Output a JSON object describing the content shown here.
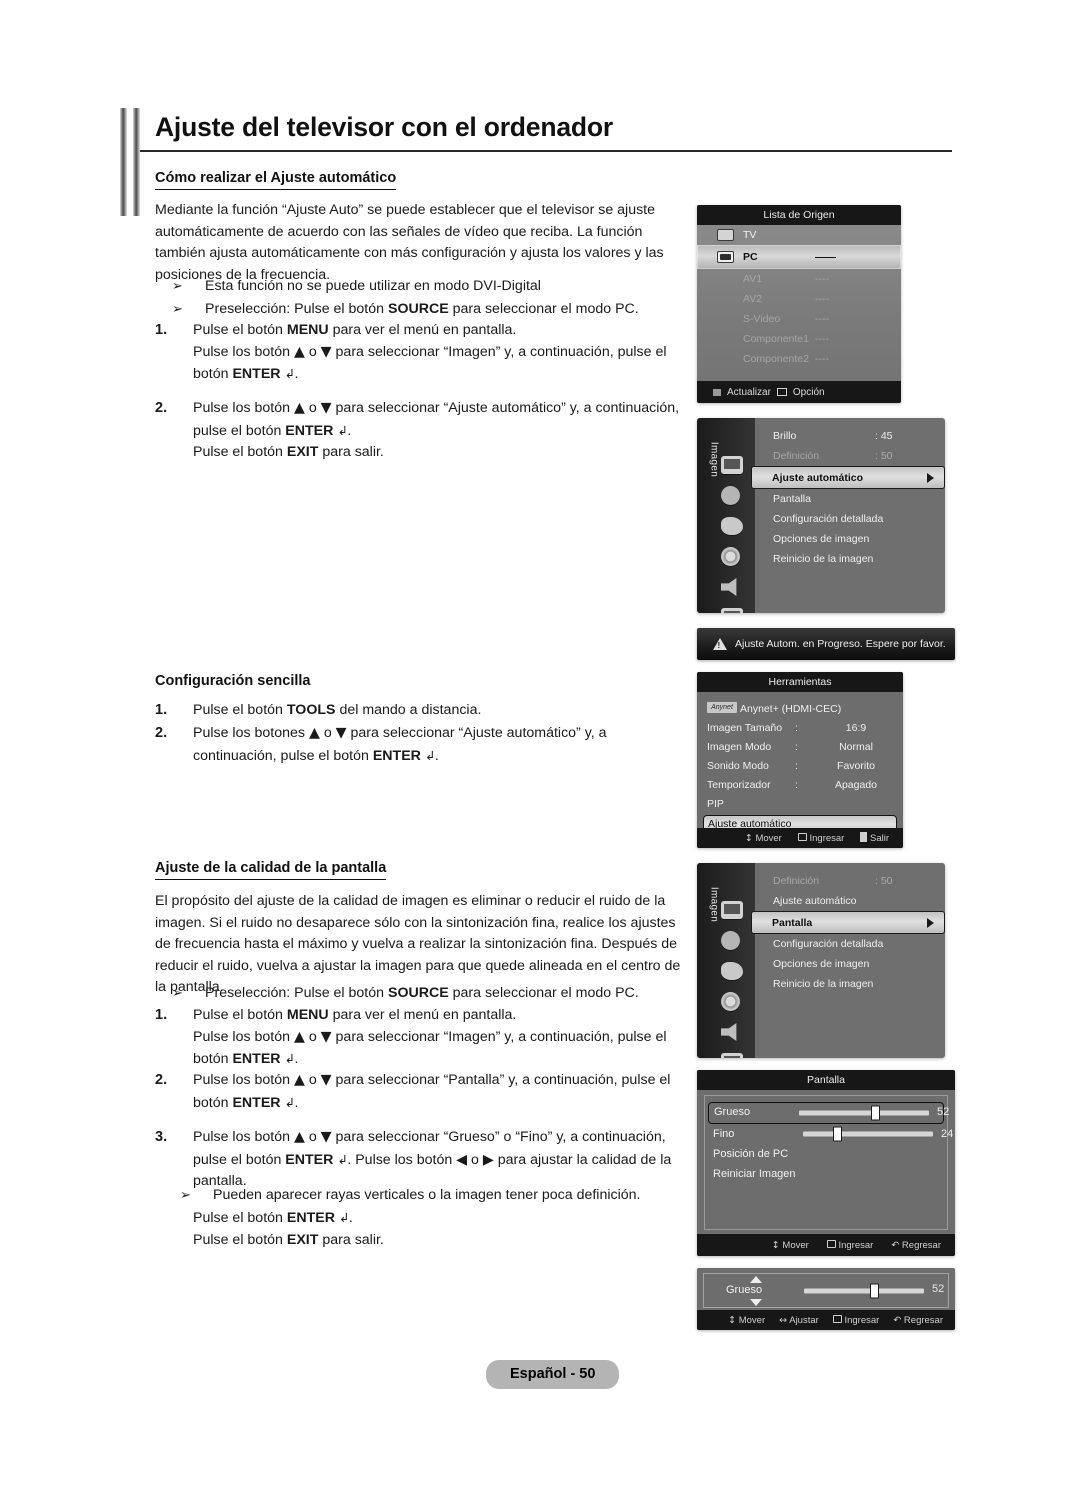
{
  "document": {
    "title": "Ajuste del televisor con el ordenador",
    "footer": "Español - 50"
  },
  "section1": {
    "heading": "Cómo realizar el Ajuste automático",
    "intro": "Mediante la función “Ajuste Auto” se puede establecer que el televisor se ajuste automáticamente de acuerdo con las señales de vídeo que reciba. La función también ajusta automáticamente con más configuración y ajusta los valores y las posiciones de la frecuencia.",
    "bullets": [
      "Esta función no se puede utilizar en modo DVI-Digital",
      "Preselección: Pulse el botón SOURCE para seleccionar el modo PC."
    ],
    "step1_num": "1.",
    "step1_line1": "Pulse el botón MENU para ver el menú en pantalla.",
    "step1_line2": "Pulse los botón ▲ o ▼ para seleccionar “Imagen” y, a continuación, pulse el botón ENTER ",
    "step2_num": "2.",
    "step2_line1": "Pulse los botón ▲ o ▼ para seleccionar “Ajuste automático” y, a continuación, pulse el botón ENTER ",
    "step2_line2": "Pulse el botón EXIT para salir."
  },
  "section2": {
    "heading": "Configuración sencilla",
    "step1_num": "1.",
    "step1_text": "Pulse el botón TOOLS del mando a distancia.",
    "step2_num": "2.",
    "step2_text": "Pulse los botones ▲ o ▼ para seleccionar “Ajuste automático” y, a continuación, pulse el botón ENTER "
  },
  "section3": {
    "heading": "Ajuste de la calidad de la pantalla",
    "intro": "El propósito del ajuste de la calidad de imagen es eliminar o reducir el ruido de la imagen. Si el ruido no desaparece sólo con la sintonización fina, realice los ajustes de frecuencia hasta el máximo y vuelva a realizar la sintonización fina. Después de reducir el ruido, vuelva a ajustar la imagen para que quede alineada en el centro de la pantalla.",
    "bullet": "Preselección: Pulse el botón SOURCE para seleccionar el modo PC.",
    "step1_num": "1.",
    "step1_line1": "Pulse el botón MENU para ver el menú en pantalla.",
    "step1_line2": "Pulse los botón ▲ o ▼ para seleccionar “Imagen” y, a continuación, pulse el botón ENTER ",
    "step2_num": "2.",
    "step2_line1": "Pulse los botón ▲ o ▼ para seleccionar “Pantalla” y, a continuación, pulse el botón ENTER ",
    "step3_num": "3.",
    "step3_line1": "Pulse los botón ▲ o ▼ para seleccionar “Grueso” o “Fino” y, a continuación, pulse el botón ENTER ",
    "step3_line1b": ". Pulse los botón ◀ o ▶ para ajustar la calidad de la pantalla.",
    "step3_bullet": "Pueden aparecer rayas verticales o la imagen tener poca definición.",
    "step3_line2": "Pulse el botón ENTER ",
    "step3_line3": "Pulse el botón EXIT para salir."
  },
  "osd": {
    "source_list": {
      "title": "Lista de Origen",
      "rows": [
        {
          "label": "TV",
          "value": "",
          "state": "normal",
          "icon": "tv-icon"
        },
        {
          "label": "PC",
          "value": "——",
          "state": "selected",
          "icon": "pc-icon"
        },
        {
          "label": "AV1",
          "value": "----",
          "state": "dim",
          "icon": ""
        },
        {
          "label": "AV2",
          "value": "----",
          "state": "dim",
          "icon": ""
        },
        {
          "label": "S-Video",
          "value": "----",
          "state": "dim",
          "icon": ""
        },
        {
          "label": "Componente1",
          "value": "----",
          "state": "dim",
          "icon": ""
        },
        {
          "label": "Componente2",
          "value": "----",
          "state": "dim",
          "icon": ""
        }
      ],
      "footer": {
        "refresh": "Actualizar",
        "option": "Opción"
      }
    },
    "picture_menu_1": {
      "tab_label": "Imagen",
      "items": [
        {
          "label": "Brillo",
          "value": ": 45",
          "state": "normal"
        },
        {
          "label": "Definición",
          "value": ": 50",
          "state": "dim"
        },
        {
          "label": "Ajuste automático",
          "value": "",
          "state": "selected"
        },
        {
          "label": "Pantalla",
          "value": "",
          "state": "normal"
        },
        {
          "label": "Configuración detallada",
          "value": "",
          "state": "normal"
        },
        {
          "label": "Opciones de imagen",
          "value": "",
          "state": "normal"
        },
        {
          "label": "Reinicio de la imagen",
          "value": "",
          "state": "normal"
        }
      ]
    },
    "warning": "Ajuste Autom. en Progreso. Espere por favor.",
    "tools_menu": {
      "title": "Herramientas",
      "items": [
        {
          "label": "Anynet+ (HDMI-CEC)",
          "colon": "",
          "value": "",
          "state": "normal",
          "chip": "Anynet"
        },
        {
          "label": "Imagen Tamaño",
          "colon": ":",
          "value": "16:9",
          "state": "normal",
          "chip": ""
        },
        {
          "label": "Imagen Modo",
          "colon": ":",
          "value": "Normal",
          "state": "normal",
          "chip": ""
        },
        {
          "label": "Sonido Modo",
          "colon": ":",
          "value": "Favorito",
          "state": "normal",
          "chip": ""
        },
        {
          "label": "Temporizador",
          "colon": ":",
          "value": "Apagado",
          "state": "normal",
          "chip": ""
        },
        {
          "label": "PIP",
          "colon": "",
          "value": "",
          "state": "normal",
          "chip": ""
        },
        {
          "label": "Ajuste automático",
          "colon": "",
          "value": "",
          "state": "selected",
          "chip": ""
        }
      ],
      "footer": {
        "move": "Mover",
        "enter": "Ingresar",
        "exit": "Salir"
      }
    },
    "picture_menu_2": {
      "tab_label": "Imagen",
      "items": [
        {
          "label": "Definición",
          "value": ": 50",
          "state": "dim"
        },
        {
          "label": "Ajuste automático",
          "value": "",
          "state": "normal"
        },
        {
          "label": "Pantalla",
          "value": "",
          "state": "selected"
        },
        {
          "label": "Configuración detallada",
          "value": "",
          "state": "normal"
        },
        {
          "label": "Opciones de imagen",
          "value": "",
          "state": "normal"
        },
        {
          "label": "Reinicio de la imagen",
          "value": "",
          "state": "normal"
        }
      ]
    },
    "screen_menu": {
      "title": "Pantalla",
      "items": [
        {
          "label": "Grueso",
          "value": "52",
          "slider": 52,
          "state": "selected"
        },
        {
          "label": "Fino",
          "value": "24",
          "slider": 24,
          "state": "normal"
        },
        {
          "label": "Posición de PC",
          "value": "",
          "slider": null,
          "state": "normal"
        },
        {
          "label": "Reiniciar Imagen",
          "value": "",
          "slider": null,
          "state": "normal"
        }
      ],
      "footer": {
        "move": "Mover",
        "enter": "Ingresar",
        "back": "Regresar"
      }
    },
    "coarse_adjust": {
      "label": "Grueso",
      "value": "52",
      "slider": 52,
      "footer": {
        "move": "Mover",
        "adjust": "Ajustar",
        "enter": "Ingresar",
        "back": "Regresar"
      }
    }
  }
}
